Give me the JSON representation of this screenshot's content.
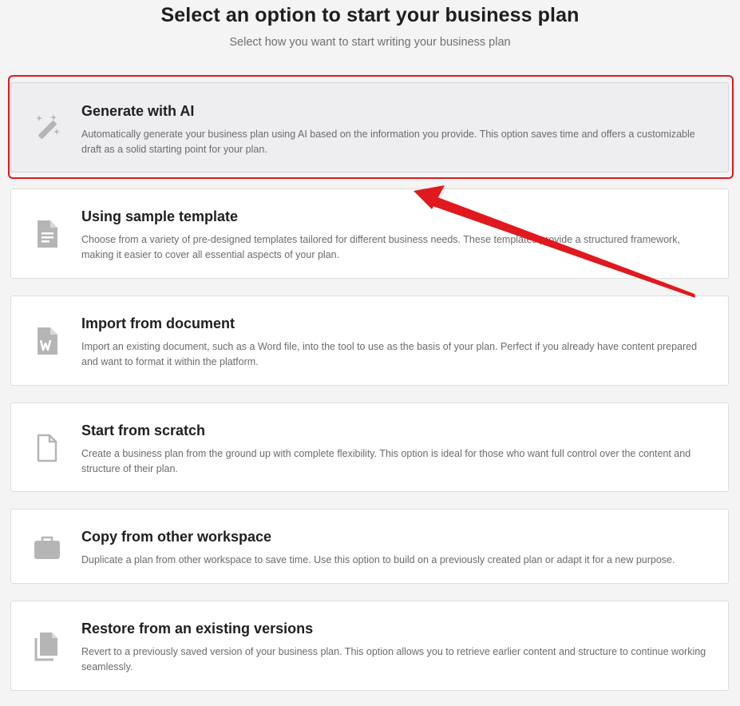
{
  "header": {
    "title": "Select an option to start your business plan",
    "subtitle": "Select how you want to start writing your business plan"
  },
  "options": [
    {
      "title": "Generate with AI",
      "description": "Automatically generate your business plan using AI based on the information you provide. This option saves time and offers a customizable draft as a solid starting point for your plan.",
      "icon": "magic-wand-icon",
      "selected": true
    },
    {
      "title": "Using sample template",
      "description": "Choose from a variety of pre-designed templates tailored for different business needs. These templates provide a structured framework, making it easier to cover all essential aspects of your plan.",
      "icon": "document-text-icon"
    },
    {
      "title": "Import from document",
      "description": "Import an existing document, such as a Word file, into the tool to use as the basis of your plan. Perfect if you already have content prepared and want to format it within the platform.",
      "icon": "word-file-icon"
    },
    {
      "title": "Start from scratch",
      "description": "Create a business plan from the ground up with complete flexibility. This option is ideal for those who want full control over the content and structure of their plan.",
      "icon": "blank-file-icon"
    },
    {
      "title": "Copy from other workspace",
      "description": "Duplicate a plan from other workspace to save time. Use this option to build on a previously created plan or adapt it for a new purpose.",
      "icon": "briefcase-icon"
    },
    {
      "title": "Restore from an existing versions",
      "description": "Revert to a previously saved version of your business plan. This option allows you to retrieve earlier content and structure to continue working seamlessly.",
      "icon": "copy-files-icon"
    }
  ],
  "colors": {
    "annotation": "#e0191e",
    "icon": "#b5b5b5"
  }
}
